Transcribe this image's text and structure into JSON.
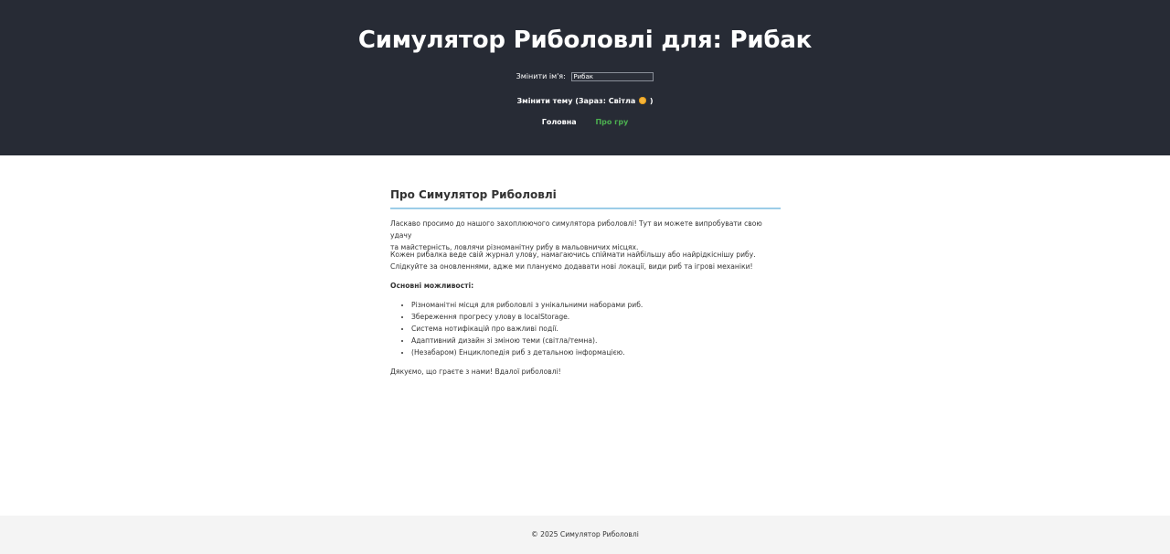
{
  "header": {
    "title": "Симулятор Риболовлі для: Рибак",
    "name_label": "Змінити ім'я:",
    "name_value": "Рибак",
    "theme_button_prefix": "Змінити тему (Зараз: Світла",
    "theme_button_suffix": ")",
    "theme_icon": "sun-icon",
    "nav": {
      "home": "Головна",
      "about": "Про гру"
    },
    "colors": {
      "background": "#272b35",
      "active_link": "#4caf50"
    }
  },
  "main": {
    "heading": "Про Симулятор Риболовлі",
    "paragraph1_line1": "Ласкаво просимо до нашого захоплюючого симулятора риболовлі! Тут ви можете випробувати свою удачу",
    "paragraph1_line2": "та майстерність, ловлячи різноманітну рибу в мальовничих місцях.",
    "paragraph2_line1": "Кожен рибалка веде свій журнал улову, намагаючись спіймати найбільшу або найрідкіснішу рибу.",
    "paragraph2_line2": "Слідкуйте за оновленнями, адже ми плануємо додавати нові локації, види риб та ігрові механіки!",
    "features_title": "Основні можливості:",
    "features": [
      "Різноманітні місця для риболовлі з унікальними наборами риб.",
      "Збереження прогресу улову в localStorage.",
      "Система нотифікацій про важливі події.",
      "Адаптивний дизайн зі зміною теми (світла/темна).",
      "(Незабаром) Енциклопедія риб з детальною інформацією."
    ],
    "thanks": "Дякуємо, що граєте з нами! Вдалої риболовлі!"
  },
  "footer": {
    "text": "© 2025 Симулятор Риболовлі"
  }
}
